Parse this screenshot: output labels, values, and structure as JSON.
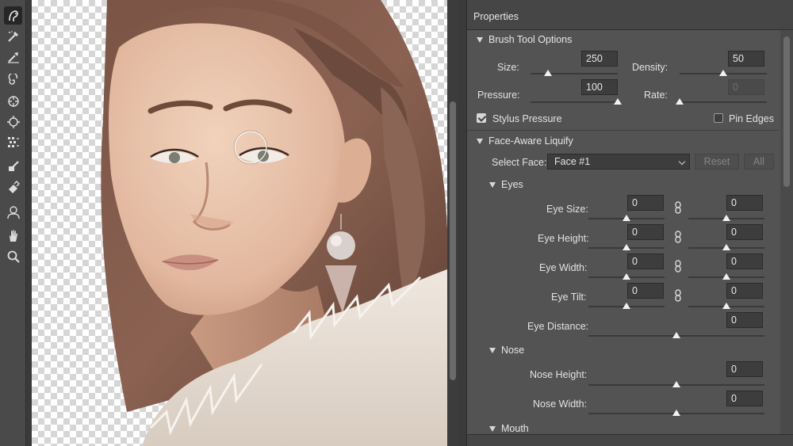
{
  "panel": {
    "title": "Properties",
    "brush": {
      "heading": "Brush Tool Options",
      "size_label": "Size:",
      "size_value": "250",
      "size_pct": 0.2,
      "density_label": "Density:",
      "density_value": "50",
      "density_pct": 0.5,
      "pressure_label": "Pressure:",
      "pressure_value": "100",
      "pressure_pct": 1.0,
      "rate_label": "Rate:",
      "rate_value": "0",
      "rate_pct": 0.0,
      "stylus_label": "Stylus Pressure",
      "stylus_checked": true,
      "pin_label": "Pin Edges",
      "pin_checked": false
    },
    "face": {
      "heading": "Face-Aware Liquify",
      "select_label": "Select Face:",
      "select_value": "Face #1",
      "reset_label": "Reset",
      "all_label": "All"
    },
    "eyes": {
      "heading": "Eyes",
      "size_label": "Eye Size:",
      "size_left": "0",
      "size_right": "0",
      "height_label": "Eye Height:",
      "height_left": "0",
      "height_right": "0",
      "width_label": "Eye Width:",
      "width_left": "0",
      "width_right": "0",
      "tilt_label": "Eye Tilt:",
      "tilt_left": "0",
      "tilt_right": "0",
      "distance_label": "Eye Distance:",
      "distance_value": "0"
    },
    "nose": {
      "heading": "Nose",
      "height_label": "Nose Height:",
      "height_value": "0",
      "width_label": "Nose Width:",
      "width_value": "0"
    },
    "mouth": {
      "heading": "Mouth"
    }
  },
  "tools": [
    "face-tool-icon",
    "forward-warp-icon",
    "reconstruct-icon",
    "twirl-icon",
    "pucker-icon",
    "bloat-icon",
    "push-left-icon",
    "freeze-mask-icon",
    "thaw-mask-icon",
    "face-icon",
    "hand-icon",
    "zoom-icon"
  ],
  "colors": {
    "panel_bg": "#535353",
    "toolbar_bg": "#4a4a4a",
    "field_bg": "#3d3d3d",
    "text": "#dcdcdc"
  }
}
